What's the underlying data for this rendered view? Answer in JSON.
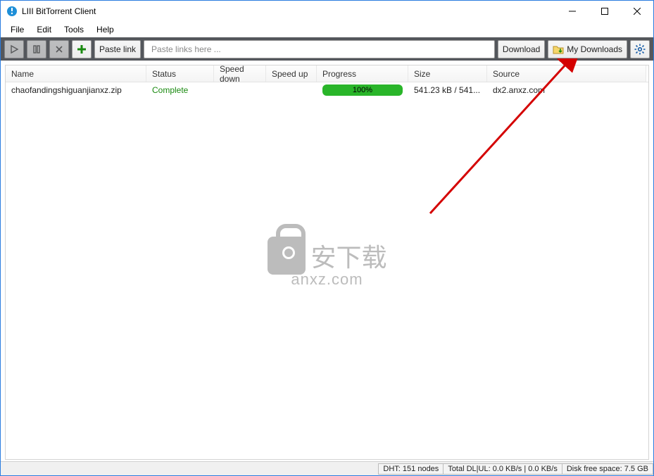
{
  "window": {
    "title": "LIII BitTorrent Client"
  },
  "menu": {
    "items": [
      "File",
      "Edit",
      "Tools",
      "Help"
    ]
  },
  "toolbar": {
    "paste_link_label": "Paste link",
    "paste_placeholder": "Paste links here ...",
    "download_label": "Download",
    "my_downloads_label": "My Downloads"
  },
  "columns": {
    "name": "Name",
    "status": "Status",
    "speed_down": "Speed down",
    "speed_up": "Speed up",
    "progress": "Progress",
    "size": "Size",
    "source": "Source"
  },
  "rows": [
    {
      "name": "chaofandingshiguanjianxz.zip",
      "status": "Complete",
      "speed_down": "",
      "speed_up": "",
      "progress_label": "100%",
      "progress_pct": 100,
      "size": "541.23 kB / 541...",
      "source": "dx2.anxz.com"
    }
  ],
  "statusbar": {
    "dht": "DHT: 151 nodes",
    "total": "Total DL|UL: 0.0 KB/s | 0.0 KB/s",
    "disk": "Disk free space: 7.5 GB"
  },
  "watermark": {
    "line1": "安下载",
    "line2": "anxz.com"
  }
}
